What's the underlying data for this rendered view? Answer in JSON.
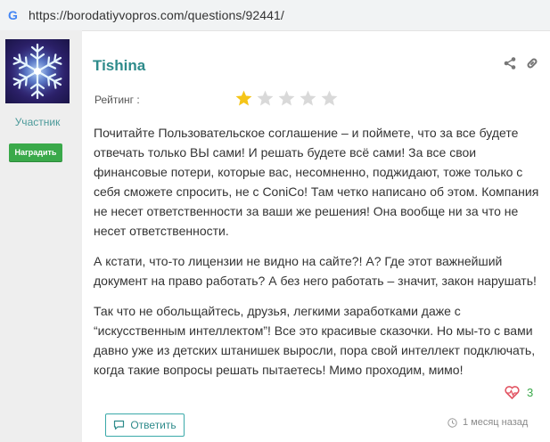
{
  "browser": {
    "url": "https://borodatiyvopros.com/questions/92441/"
  },
  "author": {
    "name": "Tishina",
    "role": "Участник",
    "award_label": "Наградить"
  },
  "rating": {
    "label": "Рейтинг :",
    "stars_filled": 1,
    "stars_total": 5
  },
  "post": {
    "paragraphs": [
      "Почитайте Пользовательское соглашение – и поймете, что за все будете отвечать только ВЫ сами! И решать будете всё сами! За все свои финансовые потери, которые вас, несомненно, поджидают, тоже только с себя сможете спросить, не с ConiCo! Там четко написано об этом. Компания не несет ответственности за ваши же решения! Она вообще ни за что не несет ответственности.",
      "А кстати, что-то лицензии не видно на сайте?! А? Где этот важнейший документ на право работать? А без него работать – значит, закон нарушать!",
      "Так что не обольщайтесь, друзья, легкими заработками даже с “искусственным интеллектом”! Все это красивые сказочки. Но мы-то с вами давно уже из детских штанишек выросли, пора свой интеллект подключать, когда такие вопросы решать пытаетесь! Мимо проходим, мимо!"
    ],
    "likes": "3",
    "reply_label": "Ответить",
    "time": "1 месяц назад"
  },
  "colors": {
    "accent": "#2e8b8b",
    "award_green": "#3aa94a",
    "star_filled": "#f5c518",
    "star_empty": "#d9d9d9",
    "heart": "#e25563"
  }
}
